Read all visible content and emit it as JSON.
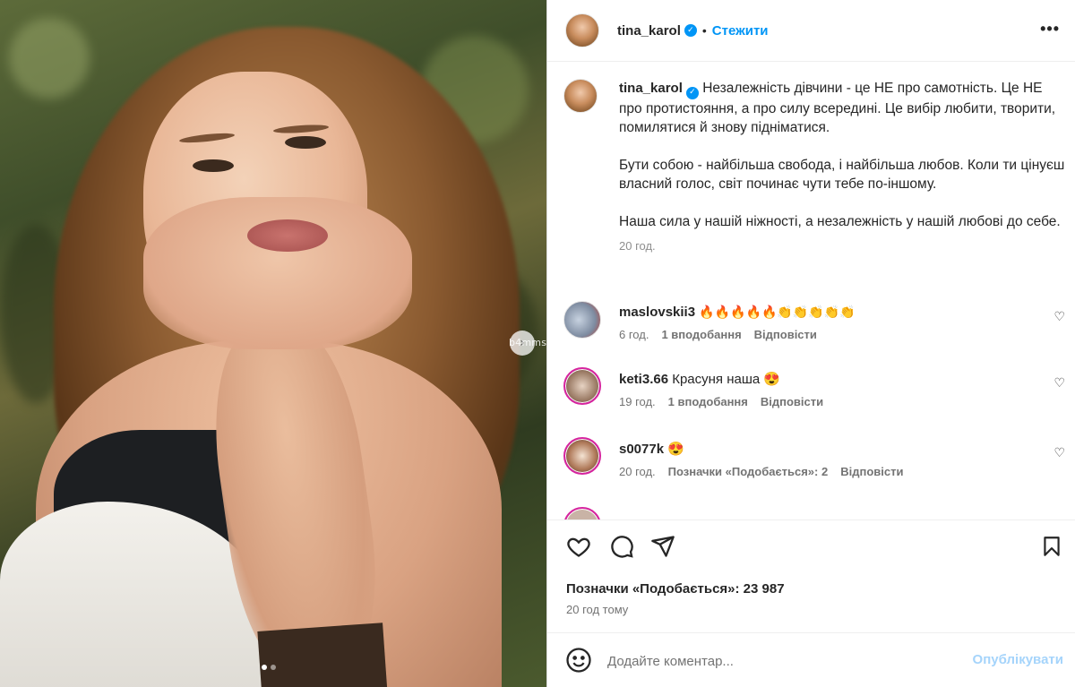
{
  "photo": {
    "watermark": "b4mms",
    "next_icon": "chevron-right-icon",
    "carousel_total": 2,
    "carousel_active": 1
  },
  "post": {
    "username": "tina_karol",
    "follow_label": "Стежити",
    "bullet": "•",
    "more_icon": "more-horizontal-icon",
    "more_glyph": "•••"
  },
  "caption": {
    "username": "tina_karol",
    "paragraphs": [
      "Незалежність дівчини - це НЕ про самотність. Це НЕ про протистояння, а про силу всередині. Це вибір любити, творити, помилятися й знову підніматися.",
      "Бути собою - найбільша свобода, і найбільша любов. Коли ти цінуєш власний голос, світ починає чути тебе по-іншому.",
      "Наша сила у нашій ніжності, а незалежність у нашій любові до себе."
    ],
    "time": "20 год."
  },
  "comments": [
    {
      "username": "maslovskii3",
      "text": "🔥🔥🔥🔥🔥👏👏👏👏👏",
      "time": "6 год.",
      "likes": "1 вподобання",
      "reply": "Відповісти"
    },
    {
      "username": "keti3.66",
      "text": "Красуня наша 😍",
      "time": "19 год.",
      "likes": "1 вподобання",
      "reply": "Відповісти"
    },
    {
      "username": "s0077k",
      "text": "😍",
      "time": "20 год.",
      "likes": "Позначки «Подобається»: 2",
      "reply": "Відповісти"
    }
  ],
  "actions": {
    "like_icon": "heart-icon",
    "comment_icon": "comment-icon",
    "share_icon": "send-icon",
    "save_icon": "bookmark-icon"
  },
  "likes_text": "Позначки «Подобається»: 23 987",
  "post_time": "20 год тому",
  "comment_bar": {
    "emoji_icon": "smiley-icon",
    "placeholder": "Додайте коментар...",
    "publish_label": "Опублікувати"
  },
  "colors": {
    "accent": "#0095f6",
    "publish_disabled": "#a5d4fb",
    "text": "#262626",
    "muted": "#737373",
    "story_ring": "#d6249f"
  }
}
